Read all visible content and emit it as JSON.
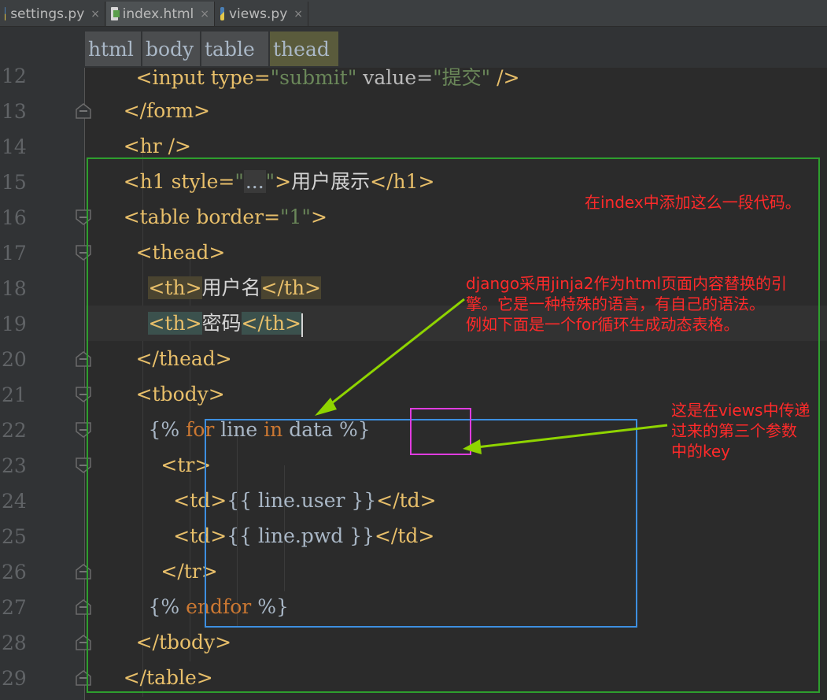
{
  "tabs": [
    {
      "label": "settings.py",
      "icon": "python-file-icon",
      "close": "×"
    },
    {
      "label": "index.html",
      "icon": "html-file-icon",
      "close": "×"
    },
    {
      "label": "views.py",
      "icon": "python-file-icon",
      "close": "×"
    }
  ],
  "breadcrumb": [
    "html",
    "body",
    "table",
    "thead"
  ],
  "line_numbers": [
    "12",
    "13",
    "14",
    "15",
    "16",
    "17",
    "18",
    "19",
    "20",
    "21",
    "22",
    "23",
    "24",
    "25",
    "26",
    "27",
    "28",
    "29"
  ],
  "code": {
    "l12": {
      "a": "<input type=",
      "b": "submit",
      "c": " value=",
      "d": "提交",
      "e": " />"
    },
    "l13": "</form>",
    "l14": "<hr />",
    "l15": {
      "a": "<h1 style=",
      "q1": "\"",
      "fold": "...",
      "q2": "\"",
      "b": ">",
      "text": "用户展示",
      "c": "</h1>"
    },
    "l16": {
      "a": "<table border=",
      "v": "\"1\"",
      "b": ">"
    },
    "l17": "<thead>",
    "l18": {
      "open": "<th>",
      "text": "用户名",
      "close": "</th>"
    },
    "l19": {
      "open": "<th>",
      "text": "密码",
      "close": "</th>"
    },
    "l20": "</thead>",
    "l21": "<tbody>",
    "l22": {
      "a": "{%",
      "for": " for ",
      "line": "line ",
      "in": "in ",
      "data": "data",
      "b": " %}"
    },
    "l23": "<tr>",
    "l24": {
      "a": "<td>",
      "b": "{{ line.user }}",
      "c": "</td>"
    },
    "l25": {
      "a": "<td>",
      "b": "{{ line.pwd }}",
      "c": "</td>"
    },
    "l26": "</tr>",
    "l27": {
      "a": "{%",
      "end": " endfor ",
      "b": "%}"
    },
    "l28": "</tbody>",
    "l29": "</table>"
  },
  "annotations": {
    "green_note": "在index中添加这么一段代码。",
    "yellow_note": [
      "django采用jinja2作为html页面内容替换的引",
      "擎。它是一种特殊的语言，有自己的语法。",
      "例如下面是一个for循环生成动态表格。"
    ],
    "blue_note": [
      "这是在views中传递",
      "过来的第三个参数",
      "中的key"
    ]
  },
  "colors": {
    "green_box": "#2e9e2e",
    "blue_box": "#3d8fe0",
    "magenta_box": "#e03ce0",
    "arrow": "#8fd400",
    "note_text": "#ff2a2a"
  }
}
